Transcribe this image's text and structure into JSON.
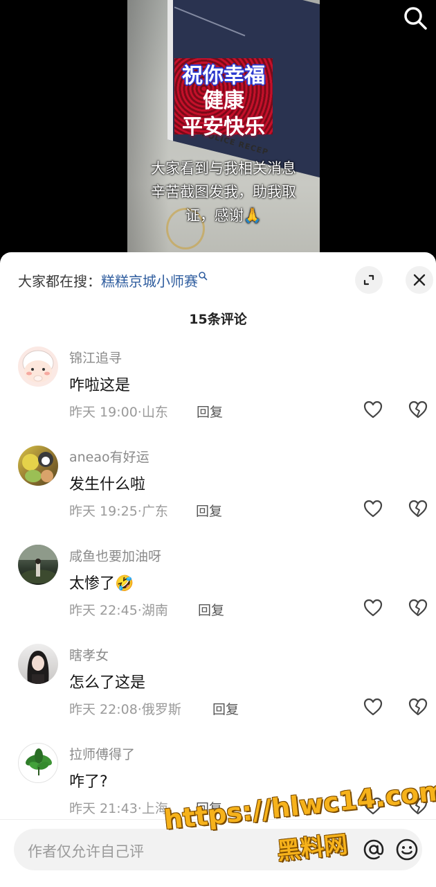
{
  "video": {
    "banner_lines": [
      "祝你幸福",
      "健康",
      "平安快乐"
    ],
    "sign_text": "POLICE RECEP",
    "caption_lines": [
      "大家看到与我相关消息",
      "辛苦截图发我，助我取",
      "证，感谢🙏"
    ]
  },
  "sheet": {
    "hot_search_prefix": "大家都在搜：",
    "hot_search_keyword": "糕糕京城小师赛",
    "comment_count": "15条评论",
    "reply_label": "回复",
    "comments": [
      {
        "username": "锦江追寻",
        "text": "咋啦这是",
        "time": "昨天 19:00",
        "location": "山东"
      },
      {
        "username": "aneao有好运",
        "text": "发生什么啦",
        "time": "昨天 19:25",
        "location": "广东"
      },
      {
        "username": "咸鱼也要加油呀",
        "text": "太惨了",
        "emoji": "🤣",
        "time": "昨天 22:45",
        "location": "湖南"
      },
      {
        "username": "瞎孝女",
        "text": "怎么了这是",
        "time": "昨天 22:08",
        "location": "俄罗斯"
      },
      {
        "username": "拉师傅得了",
        "text": "咋了?",
        "time": "昨天 21:43",
        "location": "上海"
      }
    ]
  },
  "input": {
    "placeholder": "作者仅允许自己评"
  },
  "watermark": {
    "line1": "https://hlwc14.com",
    "line2": "黑料网"
  },
  "icons": [
    "search-icon",
    "expand-icon",
    "close-icon",
    "heart-icon",
    "broken-heart-icon",
    "at-icon",
    "emoji-icon"
  ]
}
